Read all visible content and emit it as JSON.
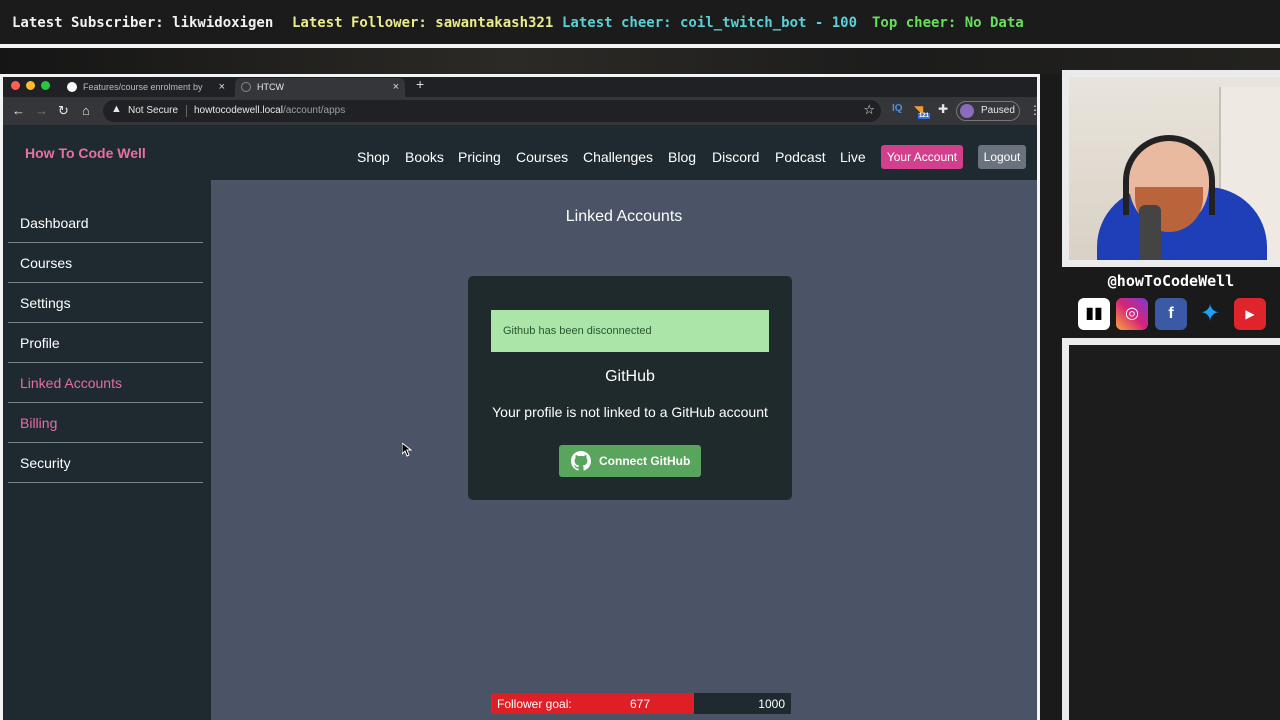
{
  "stream": {
    "latest_subscriber": "Latest Subscriber: likwidoxigen",
    "latest_follower": "Latest Follower: sawantakash321",
    "latest_cheer": "Latest cheer: coil_twitch_bot - 100",
    "top_cheer": "Top cheer: No Data",
    "handle": "@howToCodeWell",
    "socials": [
      "twitch-icon",
      "instagram-icon",
      "facebook-icon",
      "twitter-icon",
      "youtube-icon"
    ],
    "follower_goal": {
      "label": "Follower goal:",
      "current": "677",
      "target": "1000",
      "progress": 0.677
    }
  },
  "browser": {
    "tabs": [
      {
        "title": "Features/course enrolment by",
        "icon": "github-icon"
      },
      {
        "title": "HTCW",
        "icon": "globe-icon"
      }
    ],
    "security_label": "Not Secure",
    "url_host": "howtocodewell.local",
    "url_path": "/account/apps",
    "profile_status": "Paused",
    "extension_badge": "IQ",
    "rss_badge": "121"
  },
  "site": {
    "logo": "How To Code Well",
    "nav": [
      "Shop",
      "Books",
      "Pricing",
      "Courses",
      "Challenges",
      "Blog",
      "Discord",
      "Podcast",
      "Live"
    ],
    "account_button": "Your Account",
    "logout_button": "Logout",
    "sidebar": [
      {
        "label": "Dashboard",
        "active": false
      },
      {
        "label": "Courses",
        "active": false
      },
      {
        "label": "Settings",
        "active": false
      },
      {
        "label": "Profile",
        "active": false
      },
      {
        "label": "Linked Accounts",
        "active": true
      },
      {
        "label": "Billing",
        "active": true
      },
      {
        "label": "Security",
        "active": false
      }
    ],
    "page_title": "Linked Accounts",
    "alert": "Github has been disconnected",
    "provider": "GitHub",
    "status_text": "Your profile is not linked to a GitHub account",
    "connect_button": "Connect GitHub"
  },
  "colors": {
    "brand_pink": "#e870a3",
    "account_button": "#d13f8d",
    "success_alert": "#abe6a8",
    "connect_button": "#5aa55e",
    "goal_fill": "#df1f26"
  }
}
